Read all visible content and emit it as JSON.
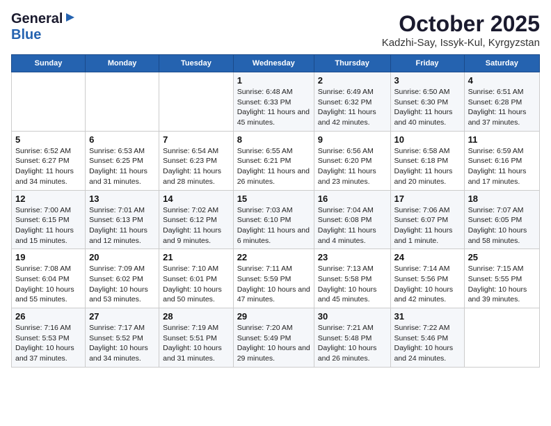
{
  "logo": {
    "line1": "General",
    "line2": "Blue"
  },
  "title": "October 2025",
  "subtitle": "Kadzhi-Say, Issyk-Kul, Kyrgyzstan",
  "weekdays": [
    "Sunday",
    "Monday",
    "Tuesday",
    "Wednesday",
    "Thursday",
    "Friday",
    "Saturday"
  ],
  "weeks": [
    [
      {
        "day": "",
        "sunrise": "",
        "sunset": "",
        "daylight": ""
      },
      {
        "day": "",
        "sunrise": "",
        "sunset": "",
        "daylight": ""
      },
      {
        "day": "",
        "sunrise": "",
        "sunset": "",
        "daylight": ""
      },
      {
        "day": "1",
        "sunrise": "Sunrise: 6:48 AM",
        "sunset": "Sunset: 6:33 PM",
        "daylight": "Daylight: 11 hours and 45 minutes."
      },
      {
        "day": "2",
        "sunrise": "Sunrise: 6:49 AM",
        "sunset": "Sunset: 6:32 PM",
        "daylight": "Daylight: 11 hours and 42 minutes."
      },
      {
        "day": "3",
        "sunrise": "Sunrise: 6:50 AM",
        "sunset": "Sunset: 6:30 PM",
        "daylight": "Daylight: 11 hours and 40 minutes."
      },
      {
        "day": "4",
        "sunrise": "Sunrise: 6:51 AM",
        "sunset": "Sunset: 6:28 PM",
        "daylight": "Daylight: 11 hours and 37 minutes."
      }
    ],
    [
      {
        "day": "5",
        "sunrise": "Sunrise: 6:52 AM",
        "sunset": "Sunset: 6:27 PM",
        "daylight": "Daylight: 11 hours and 34 minutes."
      },
      {
        "day": "6",
        "sunrise": "Sunrise: 6:53 AM",
        "sunset": "Sunset: 6:25 PM",
        "daylight": "Daylight: 11 hours and 31 minutes."
      },
      {
        "day": "7",
        "sunrise": "Sunrise: 6:54 AM",
        "sunset": "Sunset: 6:23 PM",
        "daylight": "Daylight: 11 hours and 28 minutes."
      },
      {
        "day": "8",
        "sunrise": "Sunrise: 6:55 AM",
        "sunset": "Sunset: 6:21 PM",
        "daylight": "Daylight: 11 hours and 26 minutes."
      },
      {
        "day": "9",
        "sunrise": "Sunrise: 6:56 AM",
        "sunset": "Sunset: 6:20 PM",
        "daylight": "Daylight: 11 hours and 23 minutes."
      },
      {
        "day": "10",
        "sunrise": "Sunrise: 6:58 AM",
        "sunset": "Sunset: 6:18 PM",
        "daylight": "Daylight: 11 hours and 20 minutes."
      },
      {
        "day": "11",
        "sunrise": "Sunrise: 6:59 AM",
        "sunset": "Sunset: 6:16 PM",
        "daylight": "Daylight: 11 hours and 17 minutes."
      }
    ],
    [
      {
        "day": "12",
        "sunrise": "Sunrise: 7:00 AM",
        "sunset": "Sunset: 6:15 PM",
        "daylight": "Daylight: 11 hours and 15 minutes."
      },
      {
        "day": "13",
        "sunrise": "Sunrise: 7:01 AM",
        "sunset": "Sunset: 6:13 PM",
        "daylight": "Daylight: 11 hours and 12 minutes."
      },
      {
        "day": "14",
        "sunrise": "Sunrise: 7:02 AM",
        "sunset": "Sunset: 6:12 PM",
        "daylight": "Daylight: 11 hours and 9 minutes."
      },
      {
        "day": "15",
        "sunrise": "Sunrise: 7:03 AM",
        "sunset": "Sunset: 6:10 PM",
        "daylight": "Daylight: 11 hours and 6 minutes."
      },
      {
        "day": "16",
        "sunrise": "Sunrise: 7:04 AM",
        "sunset": "Sunset: 6:08 PM",
        "daylight": "Daylight: 11 hours and 4 minutes."
      },
      {
        "day": "17",
        "sunrise": "Sunrise: 7:06 AM",
        "sunset": "Sunset: 6:07 PM",
        "daylight": "Daylight: 11 hours and 1 minute."
      },
      {
        "day": "18",
        "sunrise": "Sunrise: 7:07 AM",
        "sunset": "Sunset: 6:05 PM",
        "daylight": "Daylight: 10 hours and 58 minutes."
      }
    ],
    [
      {
        "day": "19",
        "sunrise": "Sunrise: 7:08 AM",
        "sunset": "Sunset: 6:04 PM",
        "daylight": "Daylight: 10 hours and 55 minutes."
      },
      {
        "day": "20",
        "sunrise": "Sunrise: 7:09 AM",
        "sunset": "Sunset: 6:02 PM",
        "daylight": "Daylight: 10 hours and 53 minutes."
      },
      {
        "day": "21",
        "sunrise": "Sunrise: 7:10 AM",
        "sunset": "Sunset: 6:01 PM",
        "daylight": "Daylight: 10 hours and 50 minutes."
      },
      {
        "day": "22",
        "sunrise": "Sunrise: 7:11 AM",
        "sunset": "Sunset: 5:59 PM",
        "daylight": "Daylight: 10 hours and 47 minutes."
      },
      {
        "day": "23",
        "sunrise": "Sunrise: 7:13 AM",
        "sunset": "Sunset: 5:58 PM",
        "daylight": "Daylight: 10 hours and 45 minutes."
      },
      {
        "day": "24",
        "sunrise": "Sunrise: 7:14 AM",
        "sunset": "Sunset: 5:56 PM",
        "daylight": "Daylight: 10 hours and 42 minutes."
      },
      {
        "day": "25",
        "sunrise": "Sunrise: 7:15 AM",
        "sunset": "Sunset: 5:55 PM",
        "daylight": "Daylight: 10 hours and 39 minutes."
      }
    ],
    [
      {
        "day": "26",
        "sunrise": "Sunrise: 7:16 AM",
        "sunset": "Sunset: 5:53 PM",
        "daylight": "Daylight: 10 hours and 37 minutes."
      },
      {
        "day": "27",
        "sunrise": "Sunrise: 7:17 AM",
        "sunset": "Sunset: 5:52 PM",
        "daylight": "Daylight: 10 hours and 34 minutes."
      },
      {
        "day": "28",
        "sunrise": "Sunrise: 7:19 AM",
        "sunset": "Sunset: 5:51 PM",
        "daylight": "Daylight: 10 hours and 31 minutes."
      },
      {
        "day": "29",
        "sunrise": "Sunrise: 7:20 AM",
        "sunset": "Sunset: 5:49 PM",
        "daylight": "Daylight: 10 hours and 29 minutes."
      },
      {
        "day": "30",
        "sunrise": "Sunrise: 7:21 AM",
        "sunset": "Sunset: 5:48 PM",
        "daylight": "Daylight: 10 hours and 26 minutes."
      },
      {
        "day": "31",
        "sunrise": "Sunrise: 7:22 AM",
        "sunset": "Sunset: 5:46 PM",
        "daylight": "Daylight: 10 hours and 24 minutes."
      },
      {
        "day": "",
        "sunrise": "",
        "sunset": "",
        "daylight": ""
      }
    ]
  ]
}
